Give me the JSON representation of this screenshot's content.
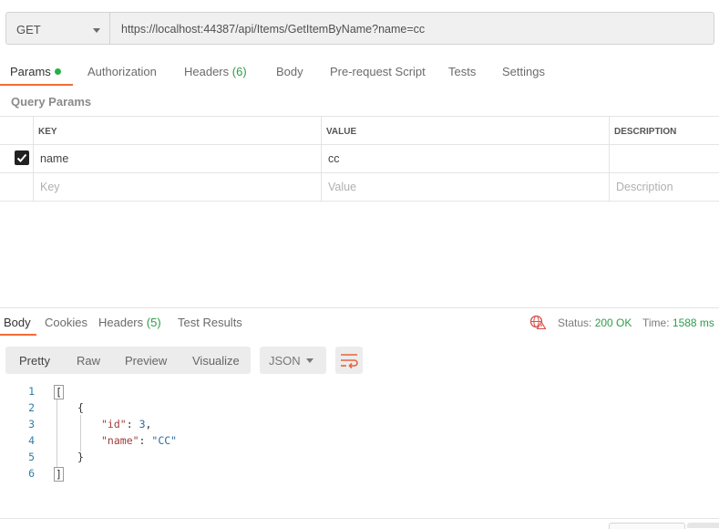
{
  "request": {
    "method": "GET",
    "url": "https://localhost:44387/api/Items/GetItemByName?name=cc"
  },
  "request_tabs": {
    "params": "Params",
    "authorization": "Authorization",
    "headers": "Headers",
    "headers_count": "(6)",
    "body": "Body",
    "prerequest": "Pre-request Script",
    "tests": "Tests",
    "settings": "Settings"
  },
  "query_params": {
    "title": "Query Params",
    "columns": {
      "key": "KEY",
      "value": "VALUE",
      "description": "DESCRIPTION"
    },
    "row": {
      "checked": true,
      "key": "name",
      "value": "cc",
      "description": ""
    },
    "placeholders": {
      "key": "Key",
      "value": "Value",
      "description": "Description"
    }
  },
  "response_tabs": {
    "body": "Body",
    "cookies": "Cookies",
    "headers": "Headers",
    "headers_count": "(5)",
    "test_results": "Test Results"
  },
  "response_status": {
    "status_label": "Status:",
    "status_value": "200 OK",
    "time_label": "Time:",
    "time_value": "1588 ms"
  },
  "view_options": {
    "pretty": "Pretty",
    "raw": "Raw",
    "preview": "Preview",
    "visualize": "Visualize",
    "format": "JSON"
  },
  "code": {
    "line_numbers": [
      "1",
      "2",
      "3",
      "4",
      "5",
      "6"
    ],
    "open_bracket": "[",
    "open_brace": "{",
    "id_key": "\"id\"",
    "id_value": "3",
    "name_key": "\"name\"",
    "name_value": "\"CC\"",
    "close_brace": "}",
    "close_bracket": "]"
  },
  "colors": {
    "accent": "#f26b3a",
    "success": "#2e9d48",
    "dot": "#26b047"
  },
  "icons": {
    "method_dropdown": "chevron-down-icon",
    "checkbox": "checkbox-checked-icon",
    "network": "globe-warning-icon",
    "format_dropdown": "chevron-down-icon",
    "wrap": "wrap-lines-icon"
  }
}
